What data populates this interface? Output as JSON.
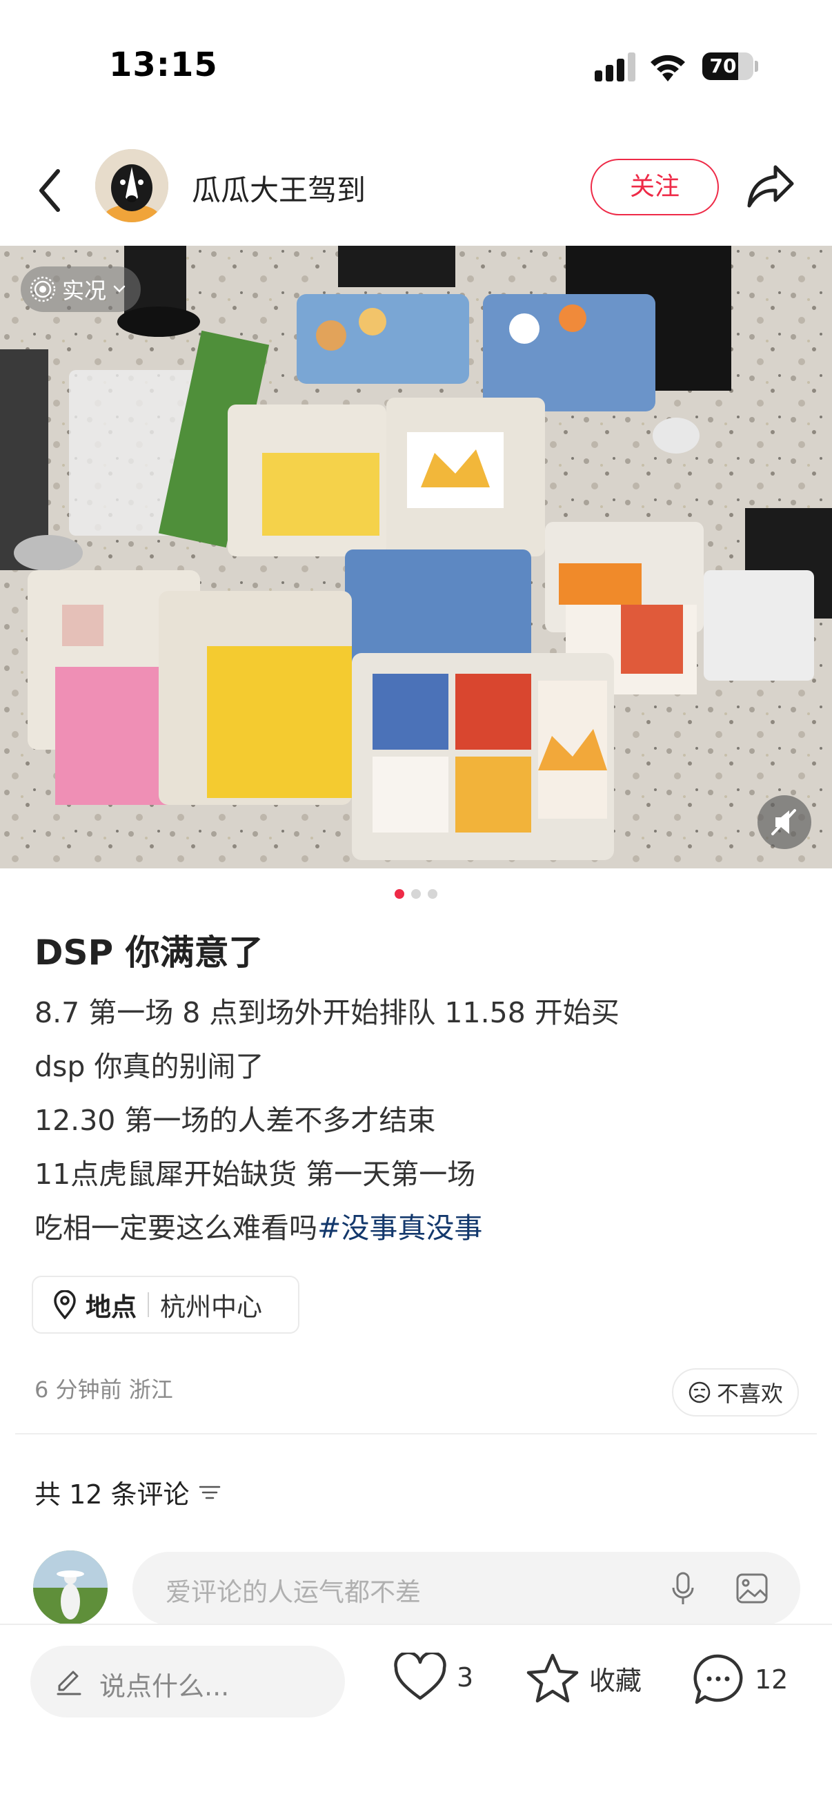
{
  "status_bar": {
    "time": "13:15",
    "battery": "70",
    "battery_level": 0.7
  },
  "header": {
    "author_name": "瓜瓜大王驾到",
    "follow_label": "关注"
  },
  "media": {
    "live_badge": "实况",
    "page_count": 3,
    "active_page": 1
  },
  "post": {
    "title": "DSP 你满意了",
    "lines": [
      "8.7 第一场 8 点到场外开始排队 11.58 开始买",
      "dsp 你真的别闹了",
      "12.30 第一场的人差不多才结束",
      "11点虎鼠犀开始缺货 第一天第一场"
    ],
    "last_line": "吃相一定要这么难看吗",
    "hashtag": "#没事真没事",
    "location_label": "地点",
    "location_value": "杭州中心",
    "meta": "6 分钟前 浙江",
    "dislike_label": "不喜欢"
  },
  "comments": {
    "count_label": "共 12 条评论",
    "input_placeholder": "爱评论的人运气都不差"
  },
  "bottom_bar": {
    "say_placeholder": "说点什么...",
    "likes": "3",
    "collect_label": "收藏",
    "comment_count": "12"
  },
  "colors": {
    "accent": "#ee2a47",
    "hashtag": "#13386c"
  }
}
